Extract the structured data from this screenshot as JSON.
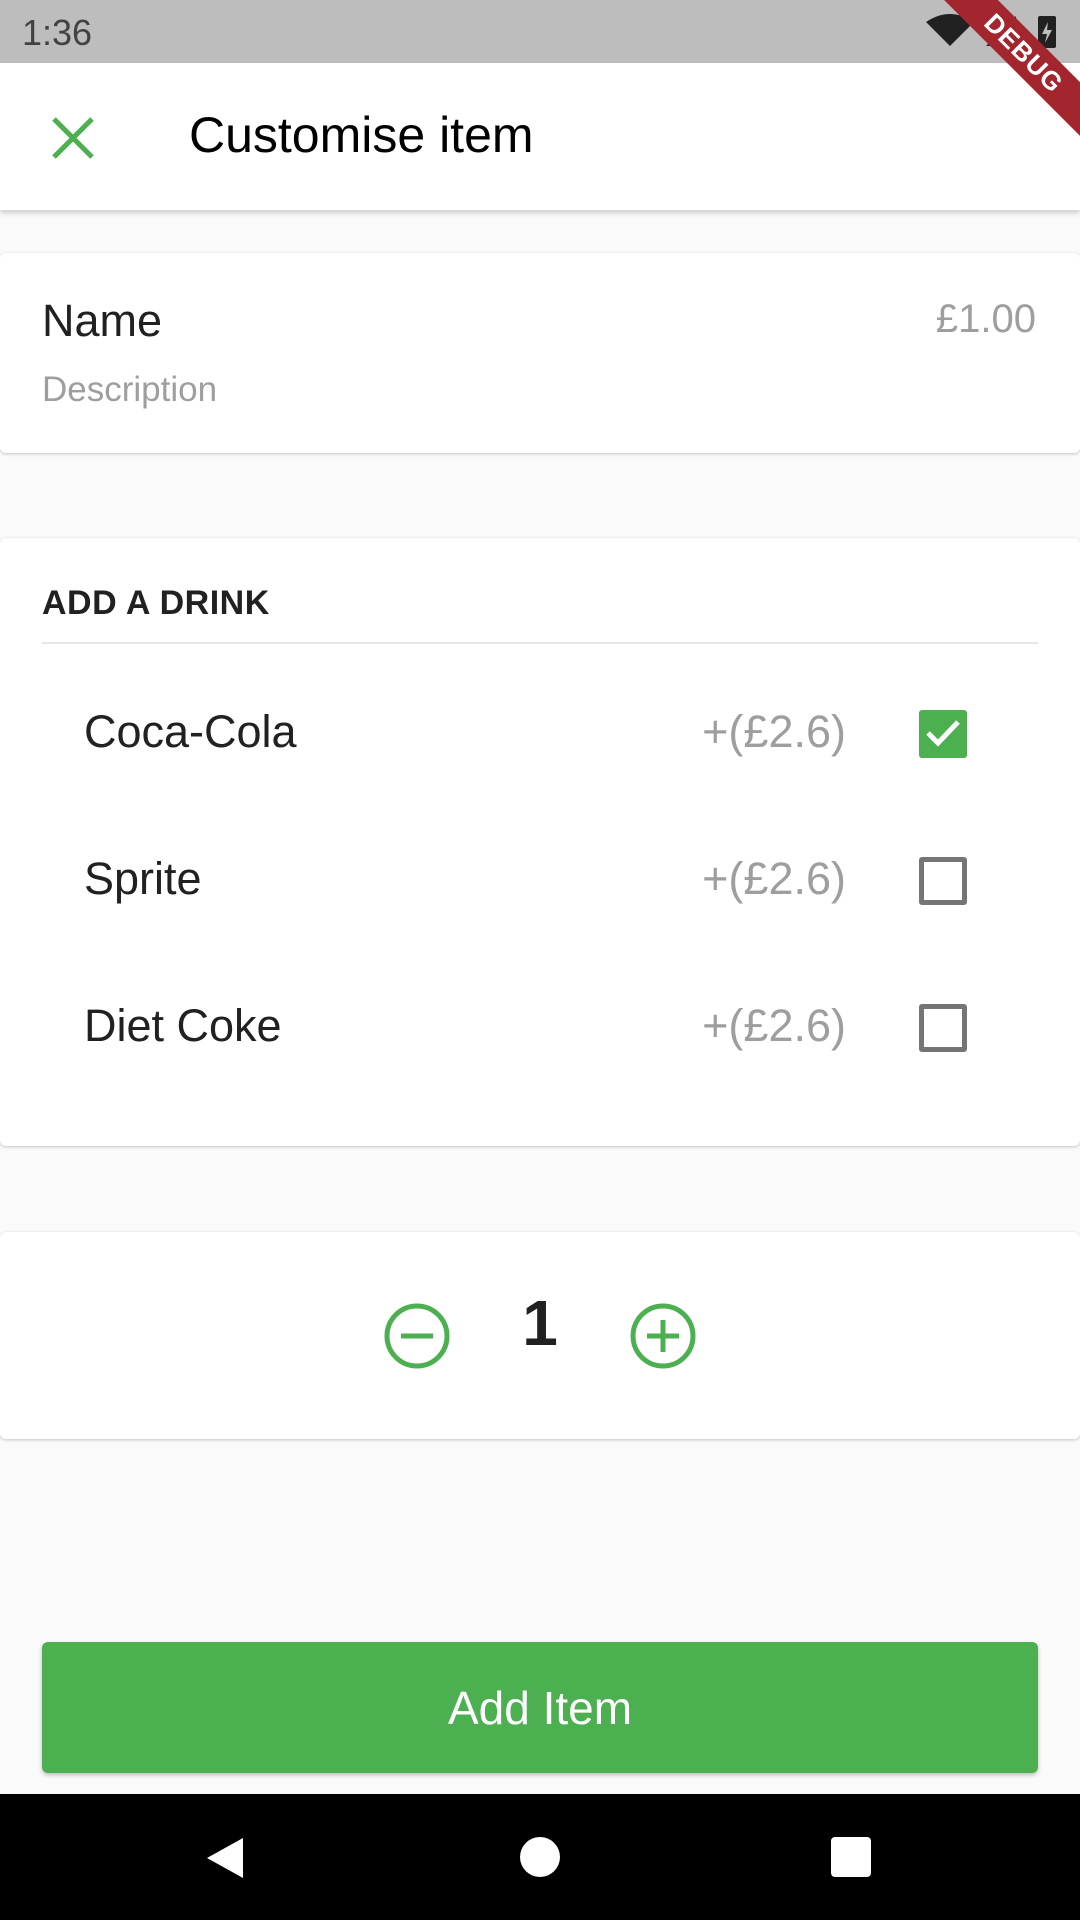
{
  "status_bar": {
    "time": "1:36"
  },
  "debug_banner": {
    "label": "DEBUG"
  },
  "app_bar": {
    "title": "Customise item",
    "close_icon": "close-icon"
  },
  "item": {
    "name": "Name",
    "price": "£1.00",
    "description": "Description"
  },
  "drinks": {
    "heading": "ADD A DRINK",
    "options": [
      {
        "name": "Coca-Cola",
        "price": "+(£2.6)",
        "checked": true
      },
      {
        "name": "Sprite",
        "price": "+(£2.6)",
        "checked": false
      },
      {
        "name": "Diet Coke",
        "price": "+(£2.6)",
        "checked": false
      }
    ]
  },
  "quantity": {
    "value": "1",
    "decrement_icon": "minus-circle-icon",
    "increment_icon": "plus-circle-icon"
  },
  "add_button": {
    "label": "Add Item"
  },
  "colors": {
    "accent": "#4caf50",
    "status_bar": "#bdbdbd",
    "debug_ribbon": "#a3262f",
    "secondary_text": "#9e9e9e"
  }
}
